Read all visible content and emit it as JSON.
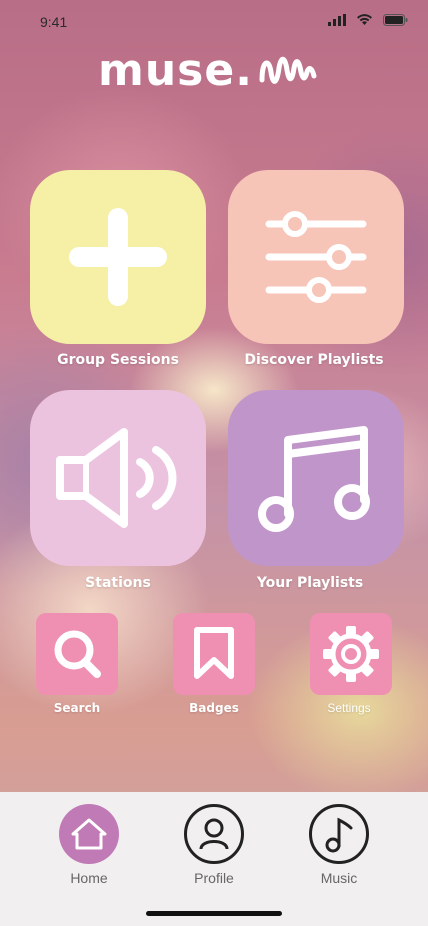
{
  "status_bar": {
    "time": "9:41"
  },
  "logo": {
    "text": "muse."
  },
  "tiles": [
    {
      "id": "group-sessions",
      "label": "Group Sessions",
      "color": "#f5f0a6",
      "icon": "plus-icon"
    },
    {
      "id": "discover-playlists",
      "label": "Discover Playlists",
      "color": "#f7c4b8",
      "icon": "sliders-icon"
    },
    {
      "id": "stations",
      "label": "Stations",
      "color": "#ecc3de",
      "icon": "speaker-icon"
    },
    {
      "id": "your-playlists",
      "label": "Your Playlists",
      "color": "#c095c9",
      "icon": "music-note-icon"
    }
  ],
  "shortcuts": [
    {
      "id": "search",
      "label": "Search",
      "icon": "search-icon"
    },
    {
      "id": "badges",
      "label": "Badges",
      "icon": "bookmark-icon"
    },
    {
      "id": "settings",
      "label": "Settings",
      "icon": "gear-icon"
    }
  ],
  "accent_colors": {
    "shortcut": "#ef8fb2",
    "nav_active": "#c07ab6"
  },
  "bottom_nav": {
    "active": "Home",
    "items": [
      {
        "label": "Home",
        "icon": "home-icon"
      },
      {
        "label": "Profile",
        "icon": "profile-icon"
      },
      {
        "label": "Music",
        "icon": "music-note-icon"
      }
    ]
  }
}
